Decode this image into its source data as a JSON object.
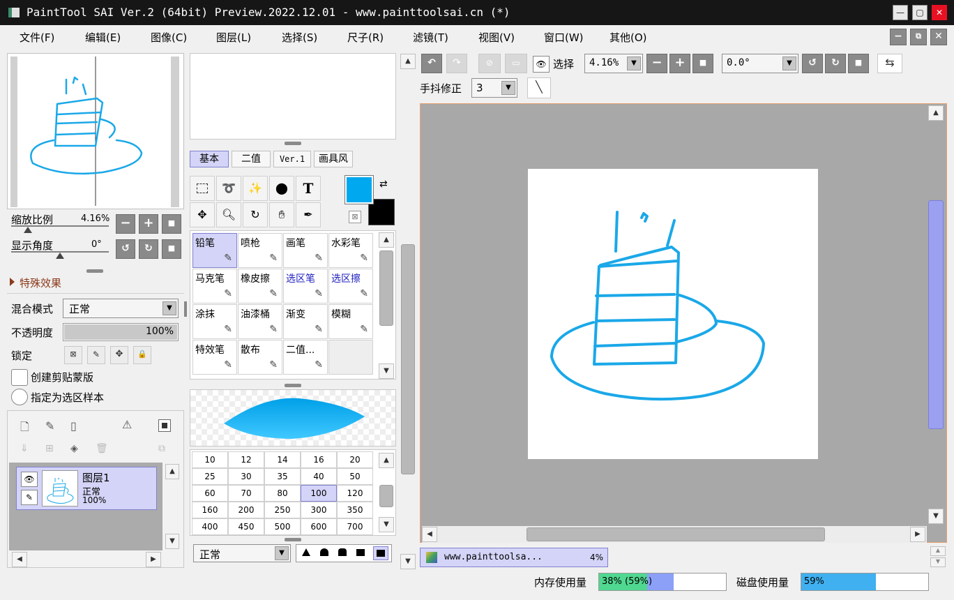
{
  "window": {
    "title": "PaintTool SAI Ver.2 (64bit) Preview.2022.12.01 - www.painttoolsai.cn (*)"
  },
  "menu": [
    "文件(F)",
    "编辑(E)",
    "图像(C)",
    "图层(L)",
    "选择(S)",
    "尺子(R)",
    "滤镜(T)",
    "视图(V)",
    "窗口(W)",
    "其他(O)"
  ],
  "navigator": {
    "zoom_label": "缩放比例",
    "zoom_value": "4.16%",
    "angle_label": "显示角度",
    "angle_value": "0°"
  },
  "effects": {
    "label": "特殊效果"
  },
  "layer_props": {
    "blend_label": "混合模式",
    "blend_value": "正常",
    "opacity_label": "不透明度",
    "opacity_value": "100%",
    "opacity": 1.0,
    "lock_label": "锁定",
    "clip_label": "创建剪贴蒙版",
    "sample_label": "指定为选区样本"
  },
  "layers": [
    {
      "name": "图层1",
      "mode": "正常",
      "opacity": "100%"
    }
  ],
  "tool_tabs": [
    "基本",
    "二值",
    "Ver.1",
    "画具风"
  ],
  "colors": {
    "primary": "#00a8f0",
    "secondary": "#000000",
    "accent": "#d4d4f8",
    "stroke": "#1aa8e8"
  },
  "brushes": [
    {
      "label": "铅笔",
      "icon": "pencil-icon",
      "active": true
    },
    {
      "label": "喷枪",
      "icon": "airbrush-icon"
    },
    {
      "label": "画笔",
      "icon": "brush-icon"
    },
    {
      "label": "水彩笔",
      "icon": "watercolor-icon"
    },
    {
      "label": "马克笔",
      "icon": "marker-icon"
    },
    {
      "label": "橡皮擦",
      "icon": "eraser-icon"
    },
    {
      "label": "选区笔",
      "icon": "select-pen-icon",
      "blue": true
    },
    {
      "label": "选区擦",
      "icon": "select-eraser-icon",
      "blue": true
    },
    {
      "label": "涂抹",
      "icon": "smudge-icon"
    },
    {
      "label": "油漆桶",
      "icon": "bucket-icon"
    },
    {
      "label": "渐变",
      "icon": "gradient-icon"
    },
    {
      "label": "模糊",
      "icon": "blur-icon"
    },
    {
      "label": "特效笔",
      "icon": "fx-pen-icon"
    },
    {
      "label": "散布",
      "icon": "scatter-icon"
    },
    {
      "label": "二值...",
      "icon": "binary-icon"
    }
  ],
  "sizes": [
    "10",
    "12",
    "14",
    "16",
    "20",
    "25",
    "30",
    "35",
    "40",
    "50",
    "60",
    "70",
    "80",
    "100",
    "120",
    "160",
    "200",
    "250",
    "300",
    "350",
    "400",
    "450",
    "500",
    "600",
    "700"
  ],
  "active_size": "100",
  "brush_mode": "正常",
  "canvas_toolbar": {
    "select_label": "选择",
    "zoom": "4.16%",
    "angle": "0.0°",
    "stabilizer_label": "手抖修正",
    "stabilizer_value": "3"
  },
  "doc_tab": {
    "name": "www.painttoolsa...",
    "zoom": "4%"
  },
  "status": {
    "mem_label": "内存使用量",
    "mem_value": "38% (59%)",
    "mem_fraction": 0.38,
    "mem_fraction2": 0.59,
    "disk_label": "磁盘使用量",
    "disk_value": "59%",
    "disk_fraction": 0.59
  }
}
